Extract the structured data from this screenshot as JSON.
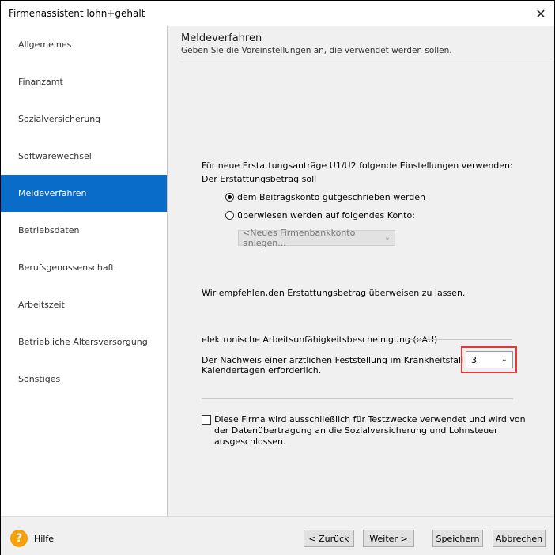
{
  "window": {
    "title": "Firmenassistent lohn+gehalt",
    "close_glyph": "✕"
  },
  "sidebar": {
    "items": [
      {
        "label": "Allgemeines"
      },
      {
        "label": "Finanzamt"
      },
      {
        "label": "Sozialversicherung"
      },
      {
        "label": "Softwarewechsel"
      },
      {
        "label": "Meldeverfahren",
        "active": true
      },
      {
        "label": "Betriebsdaten"
      },
      {
        "label": "Berufsgenossenschaft"
      },
      {
        "label": "Arbeitszeit"
      },
      {
        "label": "Betriebliche Altersversorgung"
      },
      {
        "label": "Sonstiges"
      }
    ]
  },
  "main": {
    "title": "Meldeverfahren",
    "subtitle": "Geben Sie die Voreinstellungen an, die verwendet werden sollen.",
    "refund": {
      "intro": "Für neue Erstattungsanträge U1/U2 folgende Einstellungen verwenden:",
      "label": "Der Erstattungsbetrag soll",
      "option_credit": "dem Beitragskonto gutgeschrieben werden",
      "option_transfer": "überwiesen werden auf folgendes Konto:",
      "selected": "credit",
      "account_select": "<Neues Firmenbankkonto anlegen...",
      "recommendation": "Wir empfehlen,den Erstattungsbetrag überweisen zu lassen."
    },
    "eau": {
      "heading": "elektronische Arbeitsunfähigkeitsbescheinigung (eAU)",
      "description_line1": "Der Nachweis einer ärztlichen Feststellung im Krankheitsfall ist nach",
      "description_line2": "Kalendertagen erforderlich.",
      "days_value": "3"
    },
    "test_company": {
      "checked": false,
      "line1": "Diese Firma wird ausschließlich für Testzwecke verwendet und wird von",
      "line2": "der Datenübertragung an die Sozialversicherung und Lohnsteuer",
      "line3": "ausgeschlossen."
    }
  },
  "footer": {
    "help_glyph": "?",
    "help_label": "Hilfe",
    "back_label": "< Zurück",
    "next_label": "Weiter >",
    "save_label": "Speichern",
    "cancel_label": "Abbrechen"
  },
  "colors": {
    "accent": "#0a6cc9",
    "highlight": "#e53935",
    "help": "#f5a00a"
  },
  "icons": {
    "close": "close-icon",
    "help": "help-icon",
    "dropdown": "chevron-down-icon"
  }
}
